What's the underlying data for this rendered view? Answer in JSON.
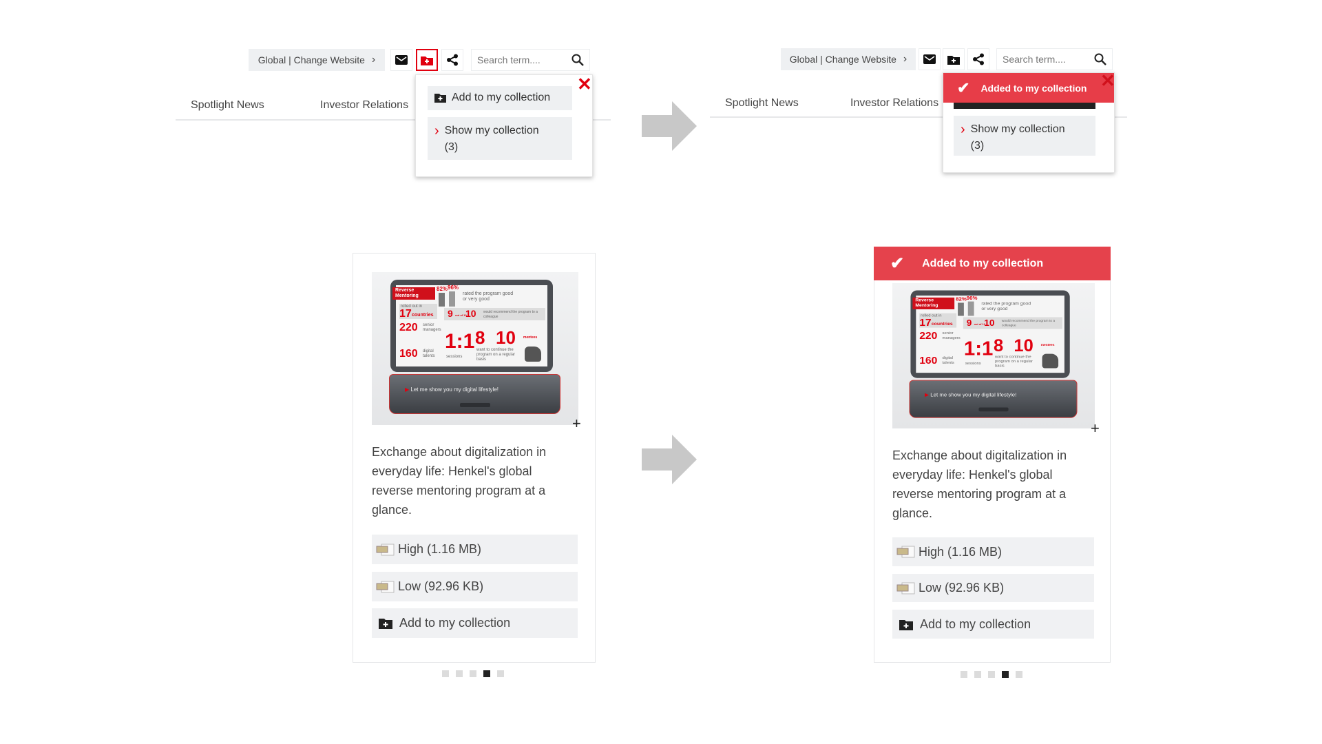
{
  "colors": {
    "accent": "#e1000f",
    "banner": "#e5424c"
  },
  "header": {
    "global_label": "Global | Change Website",
    "search_placeholder": "Search term....",
    "icons": [
      "mail-icon",
      "add-collection-icon",
      "share-icon",
      "search-icon"
    ]
  },
  "nav": {
    "items": [
      "Spotlight News",
      "Investor Relations"
    ]
  },
  "popup": {
    "add_label": "Add to my collection",
    "show_label": "Show my collection",
    "count": "(3)",
    "added_label": "Added to my collection"
  },
  "card": {
    "description": "Exchange about digitalization in everyday life: Henkel's global reverse mentoring program at a glance.",
    "downloads": [
      {
        "label": "High (1.16 MB)",
        "icon": "jpg-file-icon"
      },
      {
        "label": "Low (92.96 KB)",
        "icon": "jpg-file-icon"
      }
    ],
    "add_label": "Add to my collection",
    "added_label": "Added to my collection",
    "carousel": {
      "total": 5,
      "active": 4
    }
  },
  "infographic": {
    "ribbon": "Reverse Mentoring",
    "p1": "82%",
    "p2": "96%",
    "rated": "rated the program good or very good",
    "rolled": "rolled out in",
    "n17": "17",
    "countries": "countries",
    "n9": "9",
    "of10": "out of 10",
    "mentors": "mentors",
    "recommend": "would recommend the program to a colleague",
    "n220": "220",
    "senior": "senior managers",
    "n160": "160",
    "digital": "digital talents",
    "ratio": "1:1",
    "sessions": "sessions",
    "n8": "8",
    "n10": "10",
    "mentees": "mentees",
    "continue": "want to continue the program on a regular basis",
    "lifestyle": "Let me show you my digital lifestyle!"
  }
}
